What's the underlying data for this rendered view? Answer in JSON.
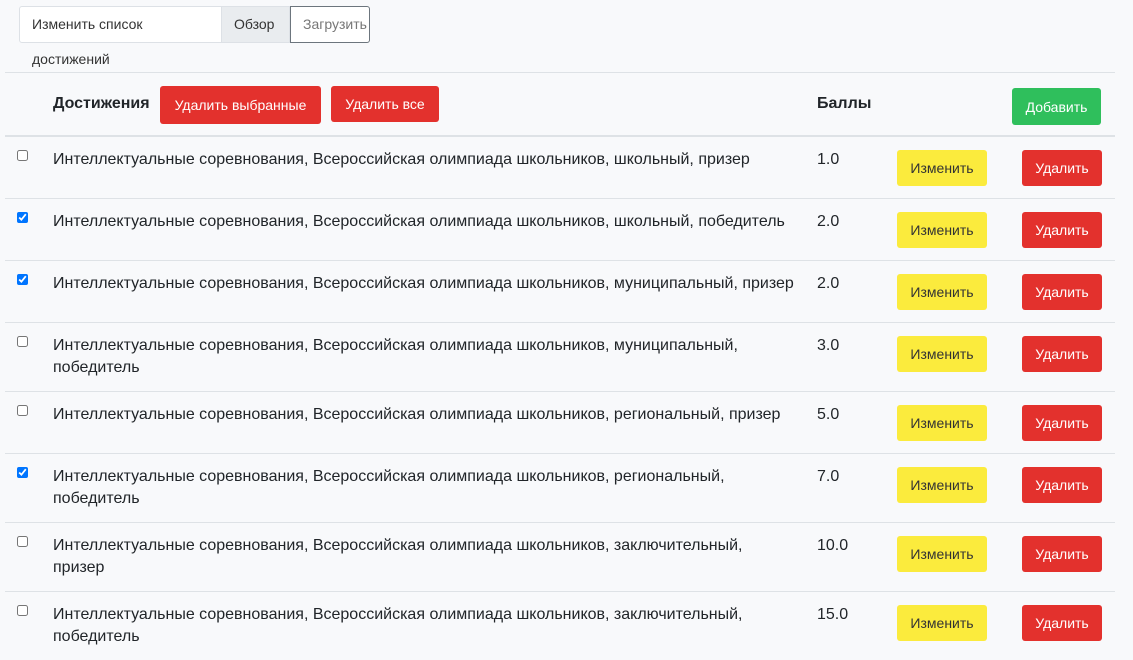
{
  "tabs": [
    {
      "label": "Изменить список достижений"
    },
    {
      "label": "Обзор"
    },
    {
      "label": "Загрузить"
    }
  ],
  "header": {
    "title": "Достижения",
    "delete_selected": "Удалить выбранные",
    "delete_all": "Удалить все",
    "score_label": "Баллы",
    "add": "Добавить"
  },
  "row_actions": {
    "edit": "Изменить",
    "delete": "Удалить"
  },
  "rows": [
    {
      "text": "Интеллектуальные соревнования, Всероссийская олимпиада школьников, школьный, призер",
      "score": "1.0",
      "checked": false
    },
    {
      "text": "Интеллектуальные соревнования, Всероссийская олимпиада школьников, школьный, победитель",
      "score": "2.0",
      "checked": true
    },
    {
      "text": "Интеллектуальные соревнования, Всероссийская олимпиада школьников, муниципальный, призер",
      "score": "2.0",
      "checked": true
    },
    {
      "text": "Интеллектуальные соревнования, Всероссийская олимпиада школьников, муниципальный, победитель",
      "score": "3.0",
      "checked": false
    },
    {
      "text": "Интеллектуальные соревнования, Всероссийская олимпиада школьников, региональный, призер",
      "score": "5.0",
      "checked": false
    },
    {
      "text": "Интеллектуальные соревнования, Всероссийская олимпиада школьников, региональный, победитель",
      "score": "7.0",
      "checked": true
    },
    {
      "text": "Интеллектуальные соревнования, Всероссийская олимпиада школьников, заключительный, призер",
      "score": "10.0",
      "checked": false
    },
    {
      "text": "Интеллектуальные соревнования, Всероссийская олимпиада школьников, заключительный, победитель",
      "score": "15.0",
      "checked": false
    }
  ]
}
